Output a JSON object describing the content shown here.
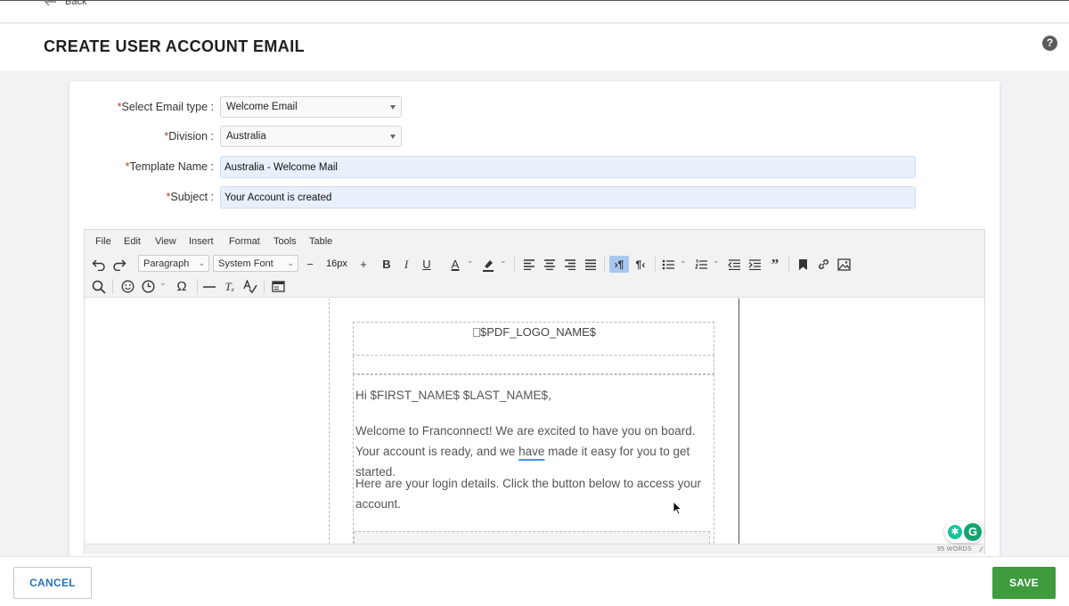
{
  "nav": {
    "back_label": "Back"
  },
  "header": {
    "title": "CREATE USER ACCOUNT EMAIL",
    "help_symbol": "?"
  },
  "form": {
    "required_mark": "*",
    "email_type": {
      "label": "Select Email type :",
      "value": "Welcome Email"
    },
    "division": {
      "label": "Division :",
      "value": "Australia"
    },
    "template_name": {
      "label": "Template Name :",
      "value": "Australia - Welcome Mail"
    },
    "subject": {
      "label": "Subject :",
      "value": "Your Account is created"
    }
  },
  "editor": {
    "menu": [
      "File",
      "Edit",
      "View",
      "Insert",
      "Format",
      "Tools",
      "Table"
    ],
    "block_format": "Paragraph",
    "font_family": "System Font",
    "font_size": "16px",
    "content": {
      "logo_alt": "$PDF_LOGO_NAME$",
      "greeting": "Hi $FIRST_NAME$ $LAST_NAME$,",
      "para1_before": "Welcome to Franconnect! We are excited to have you on board. Your account is ready, and we ",
      "para1_flagged": "have",
      "para1_after": " made it easy for you to get started.",
      "para2": "Here are your login details. Click the button below to access your account."
    },
    "word_count": "95 WORDS"
  },
  "footer": {
    "cancel_label": "CANCEL",
    "save_label": "SAVE"
  },
  "colors": {
    "save_green": "#3e9b3e",
    "cancel_blue": "#2a6ebb",
    "input_fill": "#e8f0fc",
    "active_tool": "#a8c8f0"
  },
  "icons": [
    "back-arrow-icon",
    "help-icon",
    "undo-icon",
    "redo-icon",
    "bold-icon",
    "italic-icon",
    "underline-icon",
    "text-color-icon",
    "highlight-icon",
    "align-left-icon",
    "align-center-icon",
    "align-right-icon",
    "justify-icon",
    "ltr-icon",
    "rtl-icon",
    "bullet-list-icon",
    "numbered-list-icon",
    "outdent-icon",
    "indent-icon",
    "blockquote-icon",
    "bookmark-icon",
    "link-icon",
    "image-icon",
    "search-icon",
    "emoji-icon",
    "clock-icon",
    "omega-icon",
    "horizontal-rule-icon",
    "clear-format-icon",
    "spellcheck-icon",
    "template-icon",
    "grammarly-icon"
  ]
}
